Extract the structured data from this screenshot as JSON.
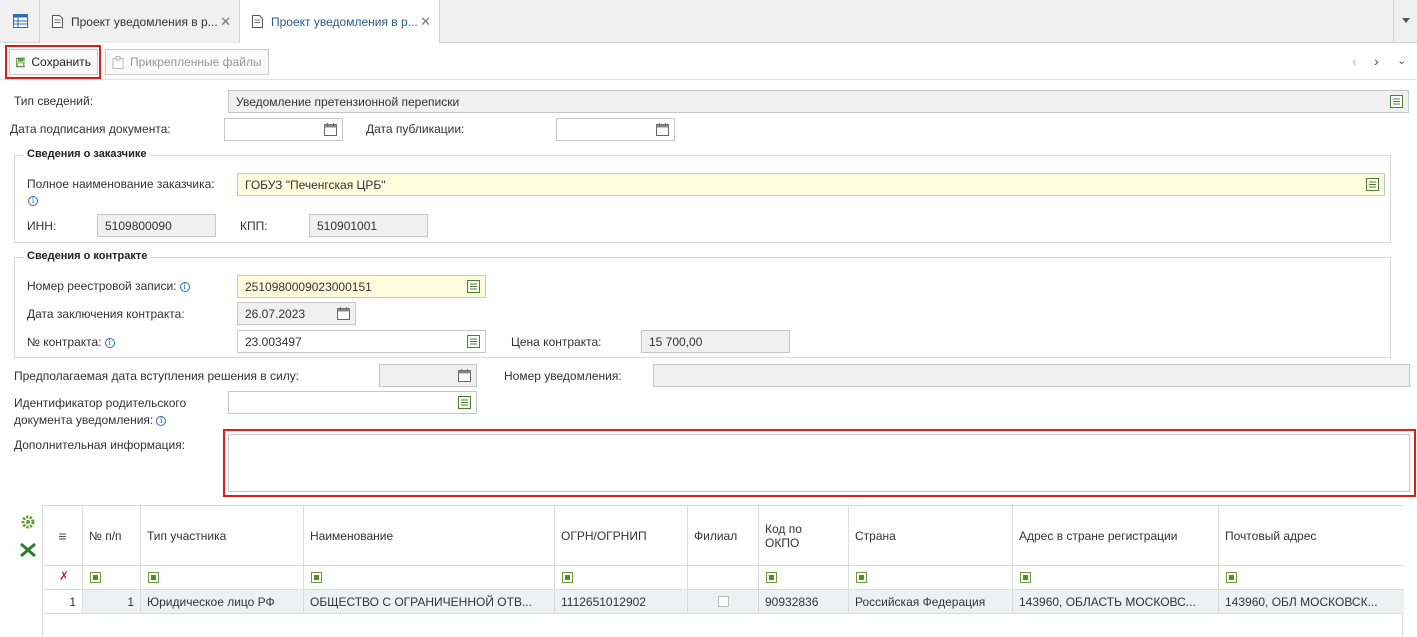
{
  "tabs": [
    {
      "label": "Проект уведомления в р..."
    },
    {
      "label": "Проект уведомления в р..."
    }
  ],
  "toolbar": {
    "save_label": "Сохранить",
    "attached_label": "Прикрепленные файлы"
  },
  "form": {
    "info_type_label": "Тип сведений:",
    "info_type_value": "Уведомление претензионной переписки",
    "sign_date_label": "Дата подписания документа:",
    "sign_date_value": "",
    "pub_date_label": "Дата публикации:",
    "pub_date_value": "",
    "customer_group_title": "Сведения о заказчике",
    "customer_name_label": "Полное наименование заказчика:",
    "customer_name_value": "ГОБУЗ \"Печенгская ЦРБ\"",
    "inn_label": "ИНН:",
    "inn_value": "5109800090",
    "kpp_label": "КПП:",
    "kpp_value": "510901001",
    "contract_group_title": "Сведения о контракте",
    "registry_label": "Номер реестровой записи:",
    "registry_value": "2510980009023000151",
    "contract_date_label": "Дата заключения контракта:",
    "contract_date_value": "26.07.2023",
    "contract_no_label": "№ контракта:",
    "contract_no_value": "23.003497",
    "price_label": "Цена контракта:",
    "price_value": "15 700,00",
    "effective_date_label": "Предполагаемая дата вступления решения в силу:",
    "effective_date_value": "",
    "notice_no_label": "Номер уведомления:",
    "notice_no_value": "",
    "parent_id_label_1": "Идентификатор родительского",
    "parent_id_label_2": "документа уведомления:",
    "parent_id_value": "",
    "extra_label": "Дополнительная информация:",
    "extra_value": ""
  },
  "grid": {
    "columns": [
      "№ п/п",
      "Тип участника",
      "Наименование",
      "ОГРН/ОГРНИП",
      "Филиал",
      "Код по ОКПО",
      "Страна",
      "Адрес в стране регистрации",
      "Почтовый адрес"
    ],
    "rows": [
      {
        "row_no": "1",
        "num": "1",
        "type": "Юридическое лицо РФ",
        "name": "ОБЩЕСТВО С ОГРАНИЧЕННОЙ ОТВ...",
        "ogrn": "1112651012902",
        "branch": false,
        "okpo": "90932836",
        "country": "Российская Федерация",
        "address": "143960, ОБЛАСТЬ МОСКОВС...",
        "postal": "143960, ОБЛ МОСКОВСК..."
      }
    ]
  },
  "colors": {
    "highlight": "#e01b1b",
    "required_bg": "#fffbdc",
    "readonly_bg": "#f0f0f0",
    "accent": "#2a6ebb"
  }
}
